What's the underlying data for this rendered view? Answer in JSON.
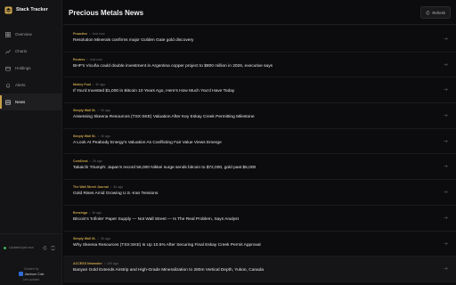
{
  "app": {
    "title": "Stack Tracker",
    "accent_color": "#c8a24a"
  },
  "sidebar": {
    "items": [
      {
        "label": "Overview",
        "icon": "grid-icon",
        "active": false
      },
      {
        "label": "Charts",
        "icon": "chart-icon",
        "active": false
      },
      {
        "label": "Holdings",
        "icon": "wallet-icon",
        "active": false
      },
      {
        "label": "Alerts",
        "icon": "bell-icon",
        "active": false
      },
      {
        "label": "News",
        "icon": "newspaper-icon",
        "active": true
      }
    ],
    "updated_text": "Updated just now",
    "created_by": "Created by",
    "author": "Jamison Cole",
    "last_updated": "Last updated"
  },
  "main": {
    "title": "Precious Metals News",
    "refresh_label": "Refresh"
  },
  "news": [
    {
      "source": "Proactive",
      "time": "Just now",
      "headline": "Resolution Minerals confirms major Golden Gate gold discovery"
    },
    {
      "source": "Reuters",
      "time": "Just now",
      "headline": "BHP's Vicuña could double investment in Argentina copper project to $800 million in 2026, executive says"
    },
    {
      "source": "Motley Fool",
      "time": "3h ago",
      "headline": "If You'd Invested $1,000 in Bitcoin 10 Years Ago, Here's How Much You'd Have Today"
    },
    {
      "source": "Simply Wall St.",
      "time": "3h ago",
      "headline": "Assessing Skeena Resources (TSX:SKE) Valuation After Key Eskay Creek Permitting Milestone"
    },
    {
      "source": "Simply Wall St.",
      "time": "3h ago",
      "headline": "A Look At Peabody Energy's Valuation As Conflicting Fair Value Views Emerge"
    },
    {
      "source": "CoinDesk",
      "time": "3h ago",
      "headline": "Takaichi Triumph: Japan's record 56,000 Nikkei surge sends bitcoin to $72,000, gold past $5,000"
    },
    {
      "source": "The Wall Street Journal",
      "time": "4h ago",
      "headline": "Gold Rises Amid Growing U.S.-Iran Tensions"
    },
    {
      "source": "Benzinga",
      "time": "3h ago",
      "headline": "Bitcoin's 'Infinite' Paper Supply — Not Wall Street — Is The Real Problem, Says Analyst"
    },
    {
      "source": "Simply Wall St.",
      "time": "3h ago",
      "headline": "Why Skeena Resources (TSX:SKE) Is Up 10.5% After Securing Final Eskay Creek Permit Approval"
    },
    {
      "source": "ACCESS Newswire",
      "time": "10h ago",
      "headline": "Banyan Gold Extends Airstrip and High-Grade Mineralization to 280m Vertical Depth, Yukon, Canada"
    }
  ]
}
